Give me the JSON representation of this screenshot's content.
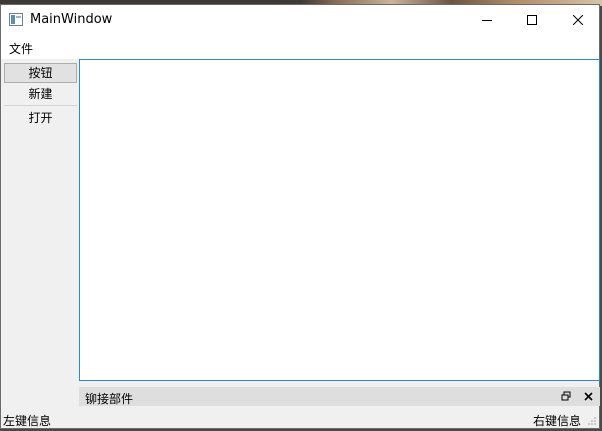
{
  "window": {
    "title": "MainWindow",
    "app_icon": "app-window-icon",
    "controls": {
      "minimize_icon": "minimize-icon",
      "maximize_icon": "maximize-icon",
      "close_icon": "close-icon"
    }
  },
  "menubar": {
    "items": [
      {
        "label": "文件"
      }
    ]
  },
  "toolbar": {
    "buttons": [
      {
        "label": "按钮",
        "state": "pressed"
      },
      {
        "label": "新建"
      },
      {
        "label": "打开"
      }
    ]
  },
  "editor": {
    "content": ""
  },
  "dock": {
    "title": "铆接部件",
    "float_icon": "restore-icon",
    "close_icon": "close-icon"
  },
  "statusbar": {
    "left": "左键信息",
    "right": "右键信息"
  },
  "colors": {
    "editor_focus_border": "#2b88d8",
    "window_bg": "#f0f0f0",
    "dock_bar_bg": "#dedede"
  }
}
